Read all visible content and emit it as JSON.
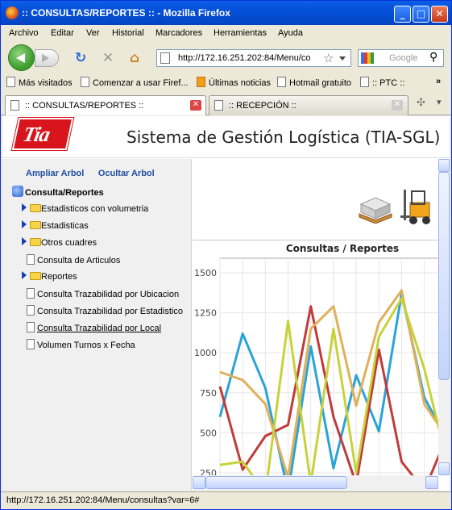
{
  "window": {
    "title": ":: CONSULTAS/REPORTES :: - Mozilla Firefox"
  },
  "menu": [
    "Archivo",
    "Editar",
    "Ver",
    "Historial",
    "Marcadores",
    "Herramientas",
    "Ayuda"
  ],
  "nav": {
    "url": "http://172.16.251.202:84/Menu/co",
    "search_placeholder": "Google"
  },
  "bookmarks": [
    "Más visitados",
    "Comenzar a usar Firef...",
    "Últimas noticias",
    "Hotmail gratuito",
    ":: PTC ::",
    "»"
  ],
  "tabs": [
    ":: CONSULTAS/REPORTES ::",
    ":: RECEPCIÓN ::"
  ],
  "page": {
    "logo": "Tia",
    "system_title": "Sistema de Gestión Logística (TIA-SGL)",
    "links": {
      "expand": "Ampliar Arbol",
      "hide": "Ocultar Arbol"
    },
    "tree": {
      "root": "Consulta/Reportes",
      "items": [
        {
          "label": "Estadisticos con volumetria",
          "type": "folder"
        },
        {
          "label": "Estadisticas",
          "type": "folder"
        },
        {
          "label": "Otros cuadres",
          "type": "folder"
        },
        {
          "label": "Consulta de Articulos",
          "type": "doc"
        },
        {
          "label": "Reportes",
          "type": "folder"
        },
        {
          "label": "Consulta Trazabilidad por Ubicacion",
          "type": "doc"
        },
        {
          "label": "Consulta Trazabilidad por Estadistico",
          "type": "doc"
        },
        {
          "label": "Consulta Trazabilidad por Local",
          "type": "doc"
        },
        {
          "label": "Volumen Turnos x Fecha",
          "type": "doc"
        }
      ]
    },
    "chart_title": "Consultas / Reportes"
  },
  "chart_data": {
    "type": "line",
    "title": "Consultas / Reportes",
    "y_ticks": [
      250,
      500,
      750,
      1000,
      1250,
      1500
    ],
    "ylim": [
      250,
      1600
    ],
    "x": [
      0,
      1,
      2,
      3,
      4,
      5,
      6,
      7,
      8,
      9,
      10,
      11
    ],
    "series": [
      {
        "color": "#2aa3d8",
        "values": [
          600,
          1120,
          780,
          130,
          1040,
          280,
          860,
          510,
          1370,
          720,
          460,
          790
        ]
      },
      {
        "color": "#c23a3a",
        "values": [
          790,
          270,
          480,
          550,
          1290,
          600,
          180,
          1020,
          320,
          140,
          480,
          730
        ]
      },
      {
        "color": "#e0b05a",
        "values": [
          880,
          830,
          680,
          220,
          1150,
          1290,
          670,
          1190,
          1390,
          680,
          470,
          540
        ]
      },
      {
        "color": "#c7d23a",
        "values": [
          300,
          320,
          120,
          1200,
          180,
          1150,
          250,
          1100,
          1340,
          900,
          320,
          940
        ]
      }
    ]
  },
  "status": "http://172.16.251.202:84/Menu/consultas?var=6#"
}
